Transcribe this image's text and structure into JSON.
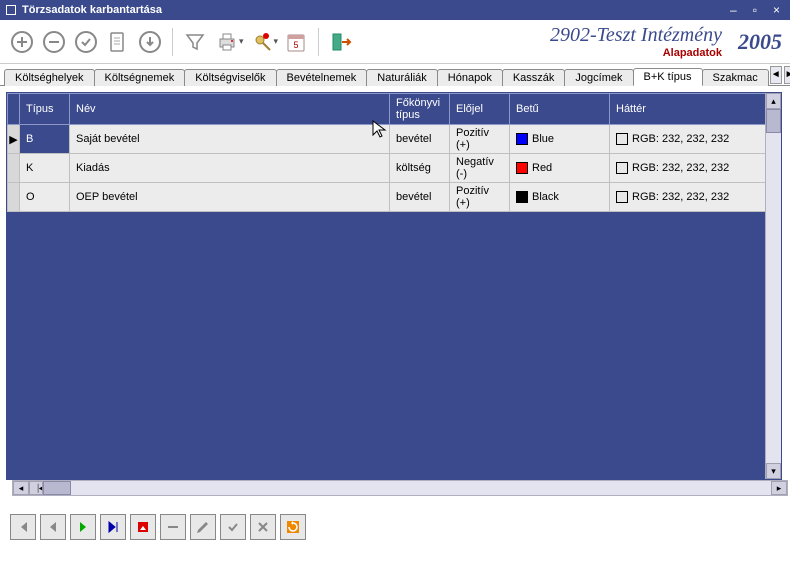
{
  "window": {
    "title": "Törzsadatok karbantartása"
  },
  "header": {
    "org_name": "2902-Teszt Intézmény",
    "subtitle": "Alapadatok",
    "year": "2005"
  },
  "tabs": [
    {
      "label": "Költséghelyek"
    },
    {
      "label": "Költségnemek"
    },
    {
      "label": "Költségviselők"
    },
    {
      "label": "Bevételnemek"
    },
    {
      "label": "Naturáliák"
    },
    {
      "label": "Hónapok"
    },
    {
      "label": "Kasszák"
    },
    {
      "label": "Jogcímek"
    },
    {
      "label": "B+K típus"
    },
    {
      "label": "Szakmac"
    }
  ],
  "grid": {
    "headers": {
      "tipus": "Típus",
      "nev": "Név",
      "fokonyv": "Főkönyvi típus",
      "elojel": "Előjel",
      "betu": "Betű",
      "hatter": "Háttér"
    },
    "rows": [
      {
        "tipus": "B",
        "nev": "Saját bevétel",
        "fokonyv": "bevétel",
        "elojel": "Pozitív (+)",
        "betu_color": "#0000ff",
        "betu": "Blue",
        "hatter_color": "#e8e8e8",
        "hatter": "RGB: 232, 232, 232"
      },
      {
        "tipus": "K",
        "nev": "Kiadás",
        "fokonyv": "költség",
        "elojel": "Negatív (-)",
        "betu_color": "#ff0000",
        "betu": "Red",
        "hatter_color": "#e8e8e8",
        "hatter": "RGB: 232, 232, 232"
      },
      {
        "tipus": "O",
        "nev": "OEP bevétel",
        "fokonyv": "bevétel",
        "elojel": "Pozitív (+)",
        "betu_color": "#000000",
        "betu": "Black",
        "hatter_color": "#e8e8e8",
        "hatter": "RGB: 232, 232, 232"
      }
    ]
  }
}
